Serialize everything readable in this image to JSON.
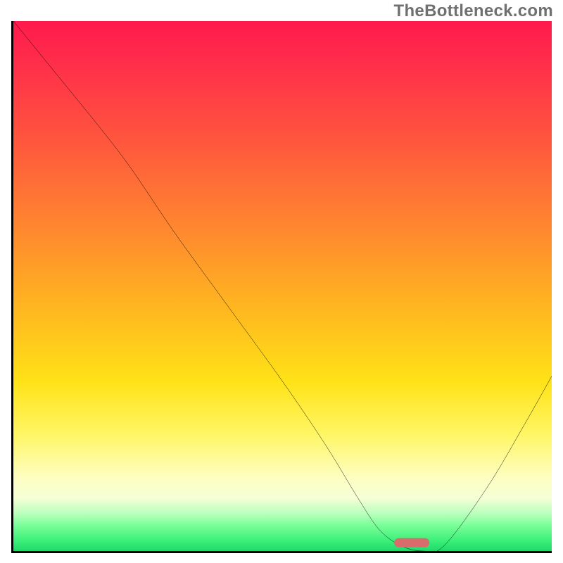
{
  "watermark": "TheBottleneck.com",
  "chart_data": {
    "type": "line",
    "title": "",
    "xlabel": "",
    "ylabel": "",
    "xlim": [
      0,
      100
    ],
    "ylim": [
      0,
      100
    ],
    "grid": false,
    "legend": false,
    "background": {
      "kind": "vertical-gradient",
      "stops": [
        {
          "pct": 0,
          "color": "#ff1a4d"
        },
        {
          "pct": 24,
          "color": "#ff5a3c"
        },
        {
          "pct": 55,
          "color": "#ffb91f"
        },
        {
          "pct": 78,
          "color": "#fff665"
        },
        {
          "pct": 90,
          "color": "#f6ffd6"
        },
        {
          "pct": 100,
          "color": "#1fd86a"
        }
      ]
    },
    "series": [
      {
        "name": "bottleneck-curve",
        "color": "#000000",
        "x": [
          0,
          8,
          16,
          22,
          30,
          40,
          50,
          58,
          64,
          68,
          72,
          76,
          80,
          88,
          95,
          100
        ],
        "y": [
          100,
          90,
          80,
          72,
          60,
          46,
          32,
          20,
          10,
          4,
          1,
          0,
          1,
          12,
          24,
          33
        ]
      }
    ],
    "annotations": [
      {
        "name": "optimal-marker",
        "shape": "rounded-rect",
        "color": "#d86b6b",
        "x": 74,
        "y": 1.6,
        "width_pct": 6.5,
        "height_pct": 1.7
      }
    ]
  }
}
